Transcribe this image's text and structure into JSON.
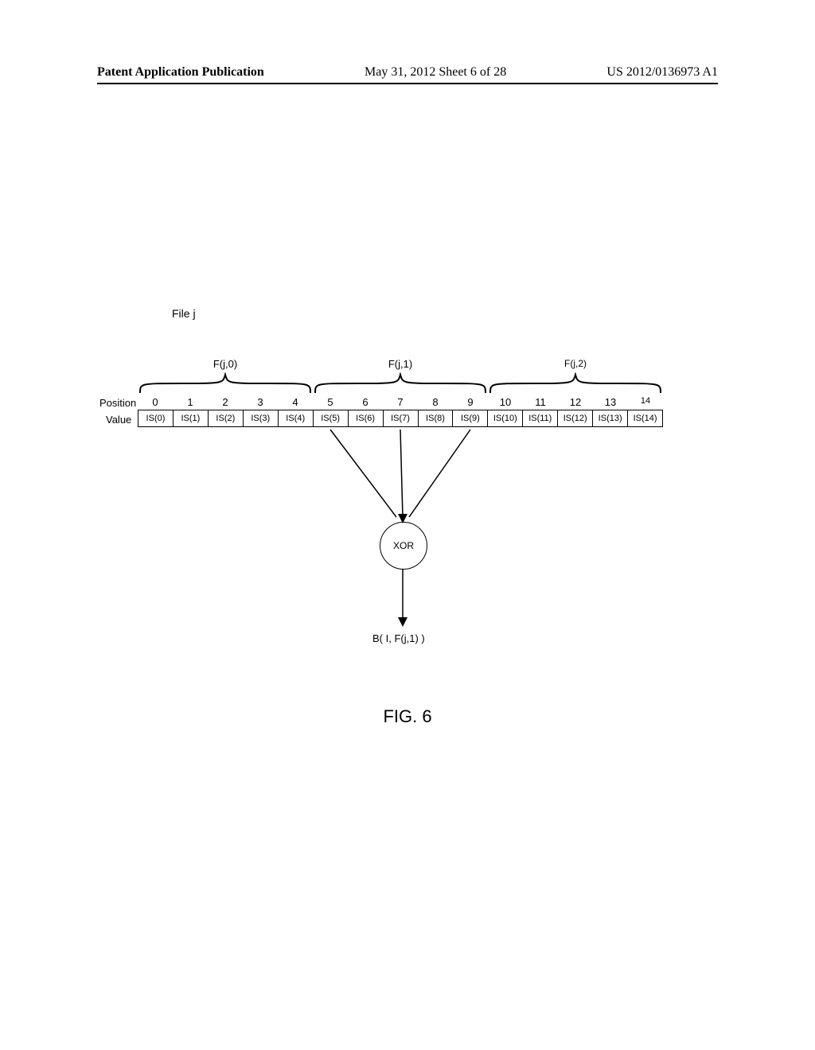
{
  "header": {
    "publication": "Patent Application Publication",
    "sheet": "May 31, 2012  Sheet 6 of 28",
    "pubnum": "US 2012/0136973 A1"
  },
  "figure": {
    "file_label": "File j",
    "row_labels": {
      "position": "Position",
      "value": "Value"
    },
    "braces": [
      {
        "label": "F(j,0)"
      },
      {
        "label": "F(j,1)"
      },
      {
        "label": "F(j,2)"
      }
    ],
    "positions": [
      "0",
      "1",
      "2",
      "3",
      "4",
      "5",
      "6",
      "7",
      "8",
      "9",
      "10",
      "11",
      "12",
      "13",
      "14"
    ],
    "values": [
      "IS(0)",
      "IS(1)",
      "IS(2)",
      "IS(3)",
      "IS(4)",
      "IS(5)",
      "IS(6)",
      "IS(7)",
      "IS(8)",
      "IS(9)",
      "IS(10)",
      "IS(11)",
      "IS(12)",
      "IS(13)",
      "IS(14)"
    ],
    "xor_label": "XOR",
    "output_label": "B( I, F(j,1) )",
    "caption": "FIG. 6"
  },
  "chart_data": {
    "type": "table",
    "title": "FIG. 6",
    "description": "File j split into 15 positions grouped into F(j,0), F(j,1), F(j,2). IS values at positions 5-9 (group F(j,1)) are XOR'd to produce B(I, F(j,1)).",
    "groups": [
      {
        "name": "F(j,0)",
        "positions": [
          0,
          1,
          2,
          3,
          4
        ]
      },
      {
        "name": "F(j,1)",
        "positions": [
          5,
          6,
          7,
          8,
          9
        ]
      },
      {
        "name": "F(j,2)",
        "positions": [
          10,
          11,
          12,
          13,
          14
        ]
      }
    ],
    "positions": [
      0,
      1,
      2,
      3,
      4,
      5,
      6,
      7,
      8,
      9,
      10,
      11,
      12,
      13,
      14
    ],
    "values": [
      "IS(0)",
      "IS(1)",
      "IS(2)",
      "IS(3)",
      "IS(4)",
      "IS(5)",
      "IS(6)",
      "IS(7)",
      "IS(8)",
      "IS(9)",
      "IS(10)",
      "IS(11)",
      "IS(12)",
      "IS(13)",
      "IS(14)"
    ],
    "operation": "XOR",
    "op_inputs_positions": [
      5,
      6,
      7,
      8,
      9
    ],
    "output": "B( I, F(j,1) )"
  }
}
